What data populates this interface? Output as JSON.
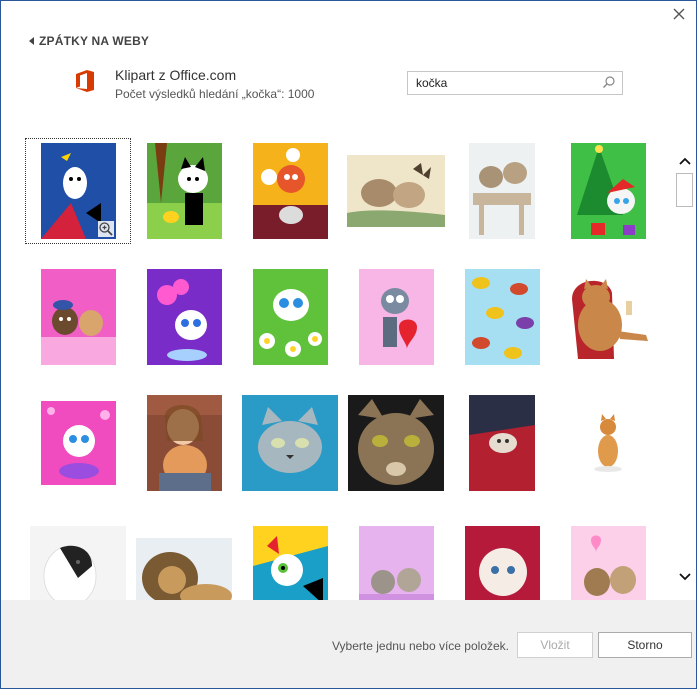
{
  "nav": {
    "back_label": "ZPÁTKY NA WEBY"
  },
  "source": {
    "title": "Klipart z Office.com",
    "result_count": "Počet výsledků hledání „kočka“: 1000"
  },
  "search": {
    "value": "kočka",
    "placeholder": ""
  },
  "footer": {
    "status": "Vyberte jednu nebo více položek.",
    "insert_label": "Vložit",
    "cancel_label": "Storno"
  },
  "colors": {
    "office_red": "#d83b01",
    "accent_blue": "#2b579a"
  },
  "icons": {
    "close": "close-icon",
    "back": "chevron-left-icon",
    "search": "search-icon",
    "zoom": "zoom-in-icon",
    "scroll_up": "chevron-up-icon",
    "scroll_down": "chevron-down-icon"
  },
  "results": [
    {
      "name": "clipart-bird-cat-blue"
    },
    {
      "name": "clipart-cat-duck-green"
    },
    {
      "name": "clipart-cats-fish-bowl"
    },
    {
      "name": "photo-vintage-kittens-butterfly"
    },
    {
      "name": "photo-vintage-kittens-fence"
    },
    {
      "name": "clipart-kitten-christmas-tree"
    },
    {
      "name": "clipart-kittens-pink"
    },
    {
      "name": "clipart-kitten-balloons-purple"
    },
    {
      "name": "clipart-kitten-flowers-green"
    },
    {
      "name": "clipart-cat-heart-pink"
    },
    {
      "name": "clipart-birds-pattern"
    },
    {
      "name": "clipart-fat-cat-armchair"
    },
    {
      "name": "clipart-kitten-love-you-mom"
    },
    {
      "name": "photo-girl-holding-kitten"
    },
    {
      "name": "clipart-grey-cat-face"
    },
    {
      "name": "photo-tabby-cat-face"
    },
    {
      "name": "photo-kitten-red-blanket"
    },
    {
      "name": "photo-small-ginger-kitten"
    },
    {
      "name": "photo-black-white-kitten"
    },
    {
      "name": "photo-lion-lying"
    },
    {
      "name": "clipart-cat-colorful-shapes"
    },
    {
      "name": "photo-two-kittens-purple"
    },
    {
      "name": "photo-white-fluffy-kitten"
    },
    {
      "name": "photo-two-kittens-hearts"
    }
  ]
}
